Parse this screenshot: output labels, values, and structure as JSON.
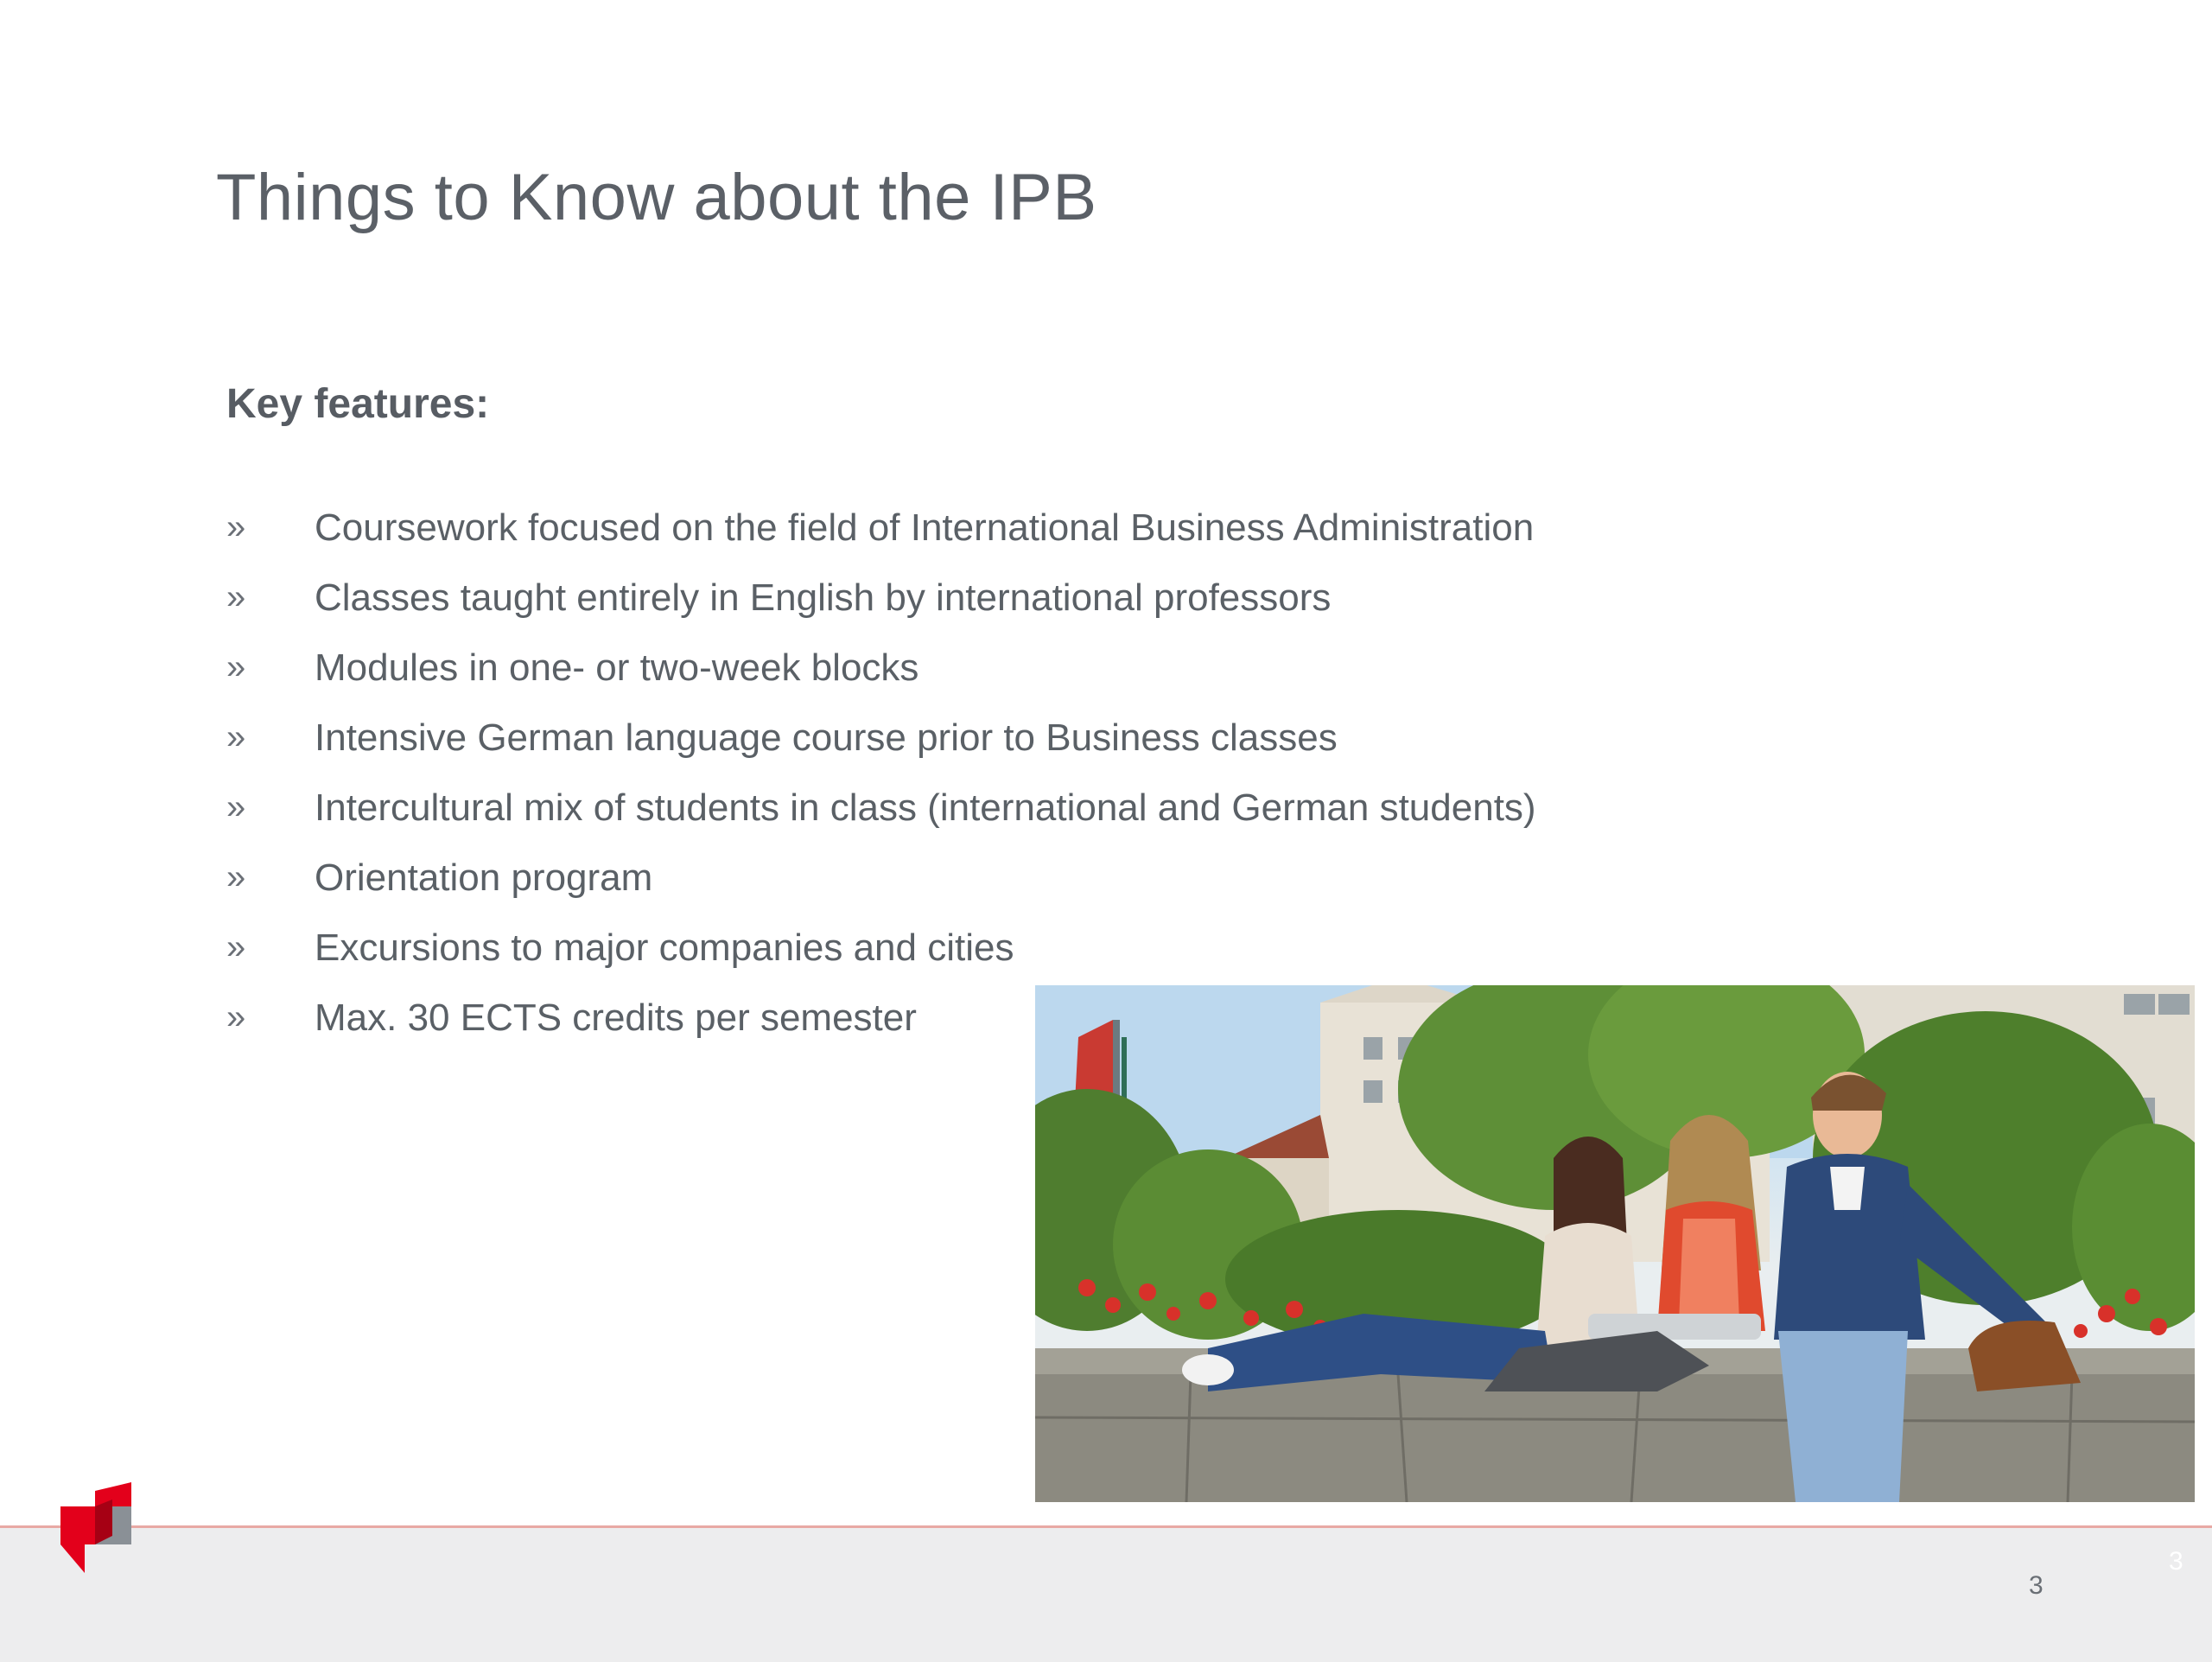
{
  "slide": {
    "title": "Things to Know about the IPB",
    "section_heading": "Key features:",
    "bullet_glyph": "»",
    "features": [
      "Coursework focused on the field of International Business Administration",
      "Classes taught entirely in English by international professors",
      "Modules in one- or two-week blocks",
      "Intensive German language course prior to Business classes",
      "Intercultural mix of students in class (international and German students)",
      "Orientation program",
      "Excursions to major companies and cities",
      "Max. 30 ECTS credits per semester"
    ],
    "page_number": "3",
    "ghost_page_number": "3"
  },
  "colors": {
    "title": "#5b6067",
    "text": "#5a6066",
    "footer_background": "#ededee",
    "footer_rule": "#e8a9a4",
    "logo_red": "#e3001b",
    "logo_grey": "#8a9096"
  }
}
